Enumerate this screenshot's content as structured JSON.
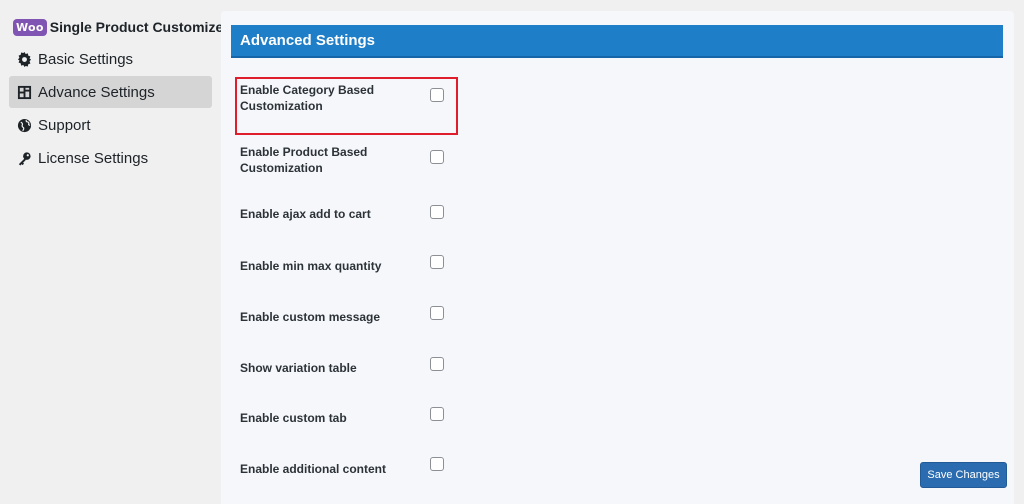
{
  "sidebar": {
    "logo_text": "Woo",
    "title": "Single Product Customizer",
    "items": [
      {
        "label": "Basic Settings",
        "icon": "gear-icon",
        "active": false
      },
      {
        "label": "Advance Settings",
        "icon": "layout-icon",
        "active": true
      },
      {
        "label": "Support",
        "icon": "globe-icon",
        "active": false
      },
      {
        "label": "License Settings",
        "icon": "key-icon",
        "active": false
      }
    ]
  },
  "panel": {
    "title": "Advanced Settings",
    "settings": [
      {
        "label": "Enable Category Based Customization",
        "checked": false
      },
      {
        "label": "Enable Product Based Customization",
        "checked": false
      },
      {
        "label": "Enable ajax add to cart",
        "checked": false
      },
      {
        "label": "Enable min max quantity",
        "checked": false
      },
      {
        "label": "Enable custom message",
        "checked": false
      },
      {
        "label": "Show variation table",
        "checked": false
      },
      {
        "label": "Enable custom tab",
        "checked": false
      },
      {
        "label": "Enable additional content",
        "checked": false
      }
    ],
    "save_label": "Save Changes"
  },
  "colors": {
    "header_bg": "#1e7ec8",
    "woo_purple": "#7f54b3",
    "highlight": "#e01e2b",
    "button_bg": "#2b6cb0"
  }
}
